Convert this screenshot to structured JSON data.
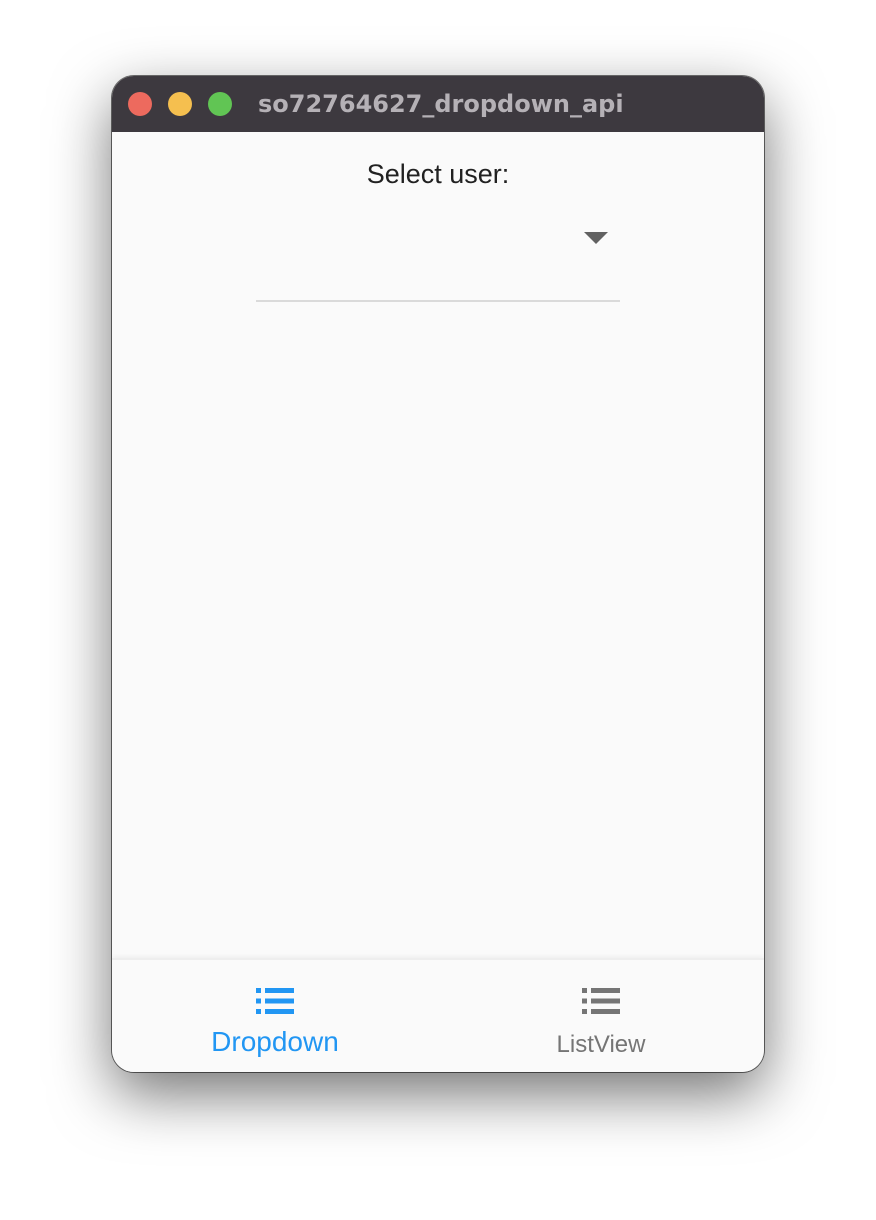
{
  "window": {
    "title": "so72764627_dropdown_api"
  },
  "main": {
    "select_label": "Select user:",
    "dropdown_value": ""
  },
  "bottom_nav": {
    "items": [
      {
        "label": "Dropdown",
        "icon": "list-icon",
        "selected": true
      },
      {
        "label": "ListView",
        "icon": "list-icon",
        "selected": false
      }
    ]
  },
  "colors": {
    "titlebar": "#3d393f",
    "active": "#2196f3",
    "inactive": "#757575"
  }
}
